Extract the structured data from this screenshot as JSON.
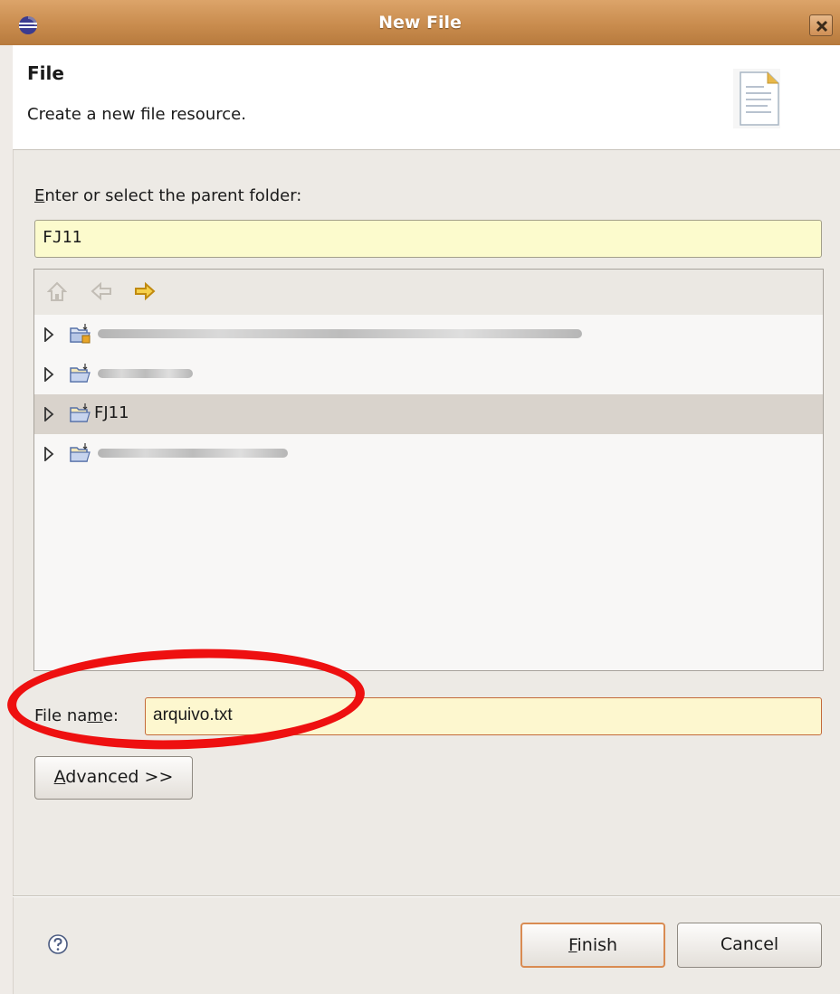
{
  "window": {
    "title": "New File"
  },
  "banner": {
    "title": "File",
    "description": "Create a new file resource."
  },
  "parent_folder": {
    "label_mnemonic": "E",
    "label_rest": "nter or select the parent folder:",
    "value": "FJ11"
  },
  "tree": {
    "items": [
      {
        "label": ""
      },
      {
        "label": ""
      },
      {
        "label": "FJ11",
        "selected": true
      },
      {
        "label": ""
      }
    ]
  },
  "file_name": {
    "label_before": "File na",
    "label_mnemonic": "m",
    "label_after": "e:",
    "value": "arquivo.txt"
  },
  "buttons": {
    "advanced_mnemonic": "A",
    "advanced_rest": "dvanced >>",
    "finish_mnemonic": "F",
    "finish_rest": "inish",
    "cancel": "Cancel"
  },
  "colors": {
    "annotation": "#ee1010",
    "title_bar": "#c98c4e",
    "input_bg": "#fcfbcd"
  }
}
